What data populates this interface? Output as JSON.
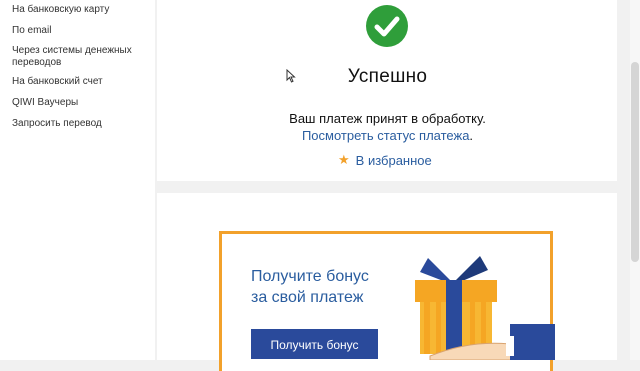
{
  "sidebar": {
    "items": [
      {
        "label": "На банковскую карту"
      },
      {
        "label": "По email"
      },
      {
        "label": "Через системы денежных переводов"
      },
      {
        "label": "На банковский счет"
      },
      {
        "label": "QIWI Ваучеры"
      },
      {
        "label": "Запросить перевод"
      }
    ]
  },
  "success": {
    "icon": "check-circle-icon",
    "title": "Успешно",
    "message": "Ваш платеж принят в обработку.",
    "status_link": "Посмотреть статус платежа",
    "status_suffix": ".",
    "favorite_label": "В избранное",
    "accent_color": "#2f9e3a"
  },
  "promo": {
    "text": "Получите бонус\nза свой платеж",
    "button_label": "Получить бонус",
    "border_color": "#f2a12b",
    "button_color": "#2a4a9b"
  }
}
